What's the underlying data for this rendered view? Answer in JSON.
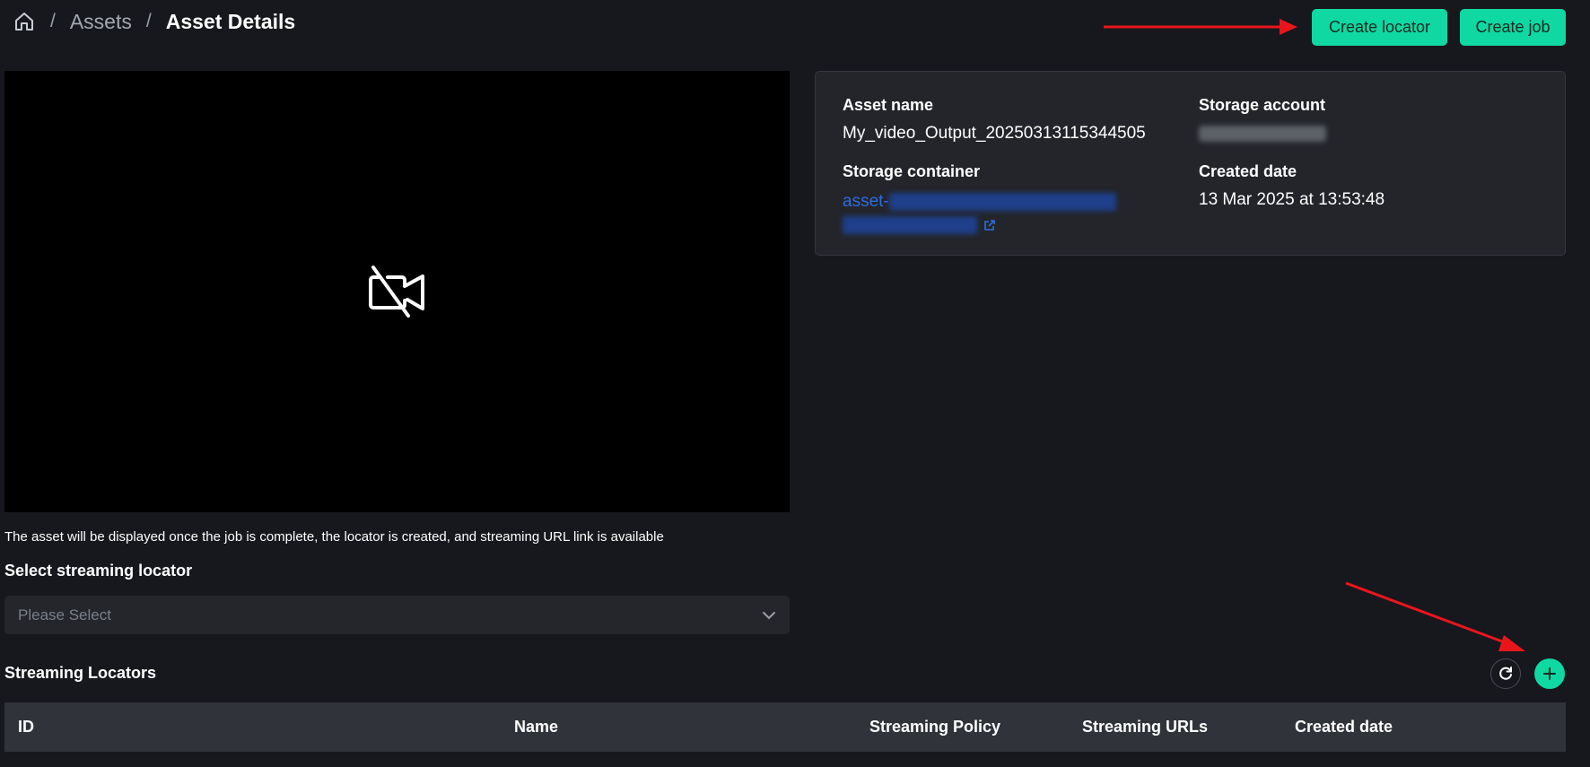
{
  "breadcrumb": {
    "home_icon": "home-icon",
    "separator": "/",
    "assets": "Assets",
    "current": "Asset Details"
  },
  "header": {
    "create_locator": "Create locator",
    "create_job": "Create job"
  },
  "video": {
    "icon": "video-off-icon",
    "hint": "The asset will be displayed once the job is complete, the locator is created, and streaming URL link is available"
  },
  "locator_select": {
    "label": "Select streaming locator",
    "placeholder": "Please Select"
  },
  "asset_info": {
    "asset_name_label": "Asset name",
    "asset_name": "My_video_Output_20250313115344505",
    "storage_account_label": "Storage account",
    "storage_container_label": "Storage container",
    "storage_container_prefix": "asset-",
    "created_date_label": "Created date",
    "created_date": "13 Mar 2025 at 13:53:48"
  },
  "streaming_locators": {
    "title": "Streaming Locators",
    "columns": [
      "ID",
      "Name",
      "Streaming Policy",
      "Streaming URLs",
      "Created date"
    ]
  },
  "colors": {
    "background": "#16181d",
    "accent": "#10d8a2",
    "card": "#23252b",
    "link": "#2e6de0",
    "annotation_arrow": "#e8161b"
  }
}
